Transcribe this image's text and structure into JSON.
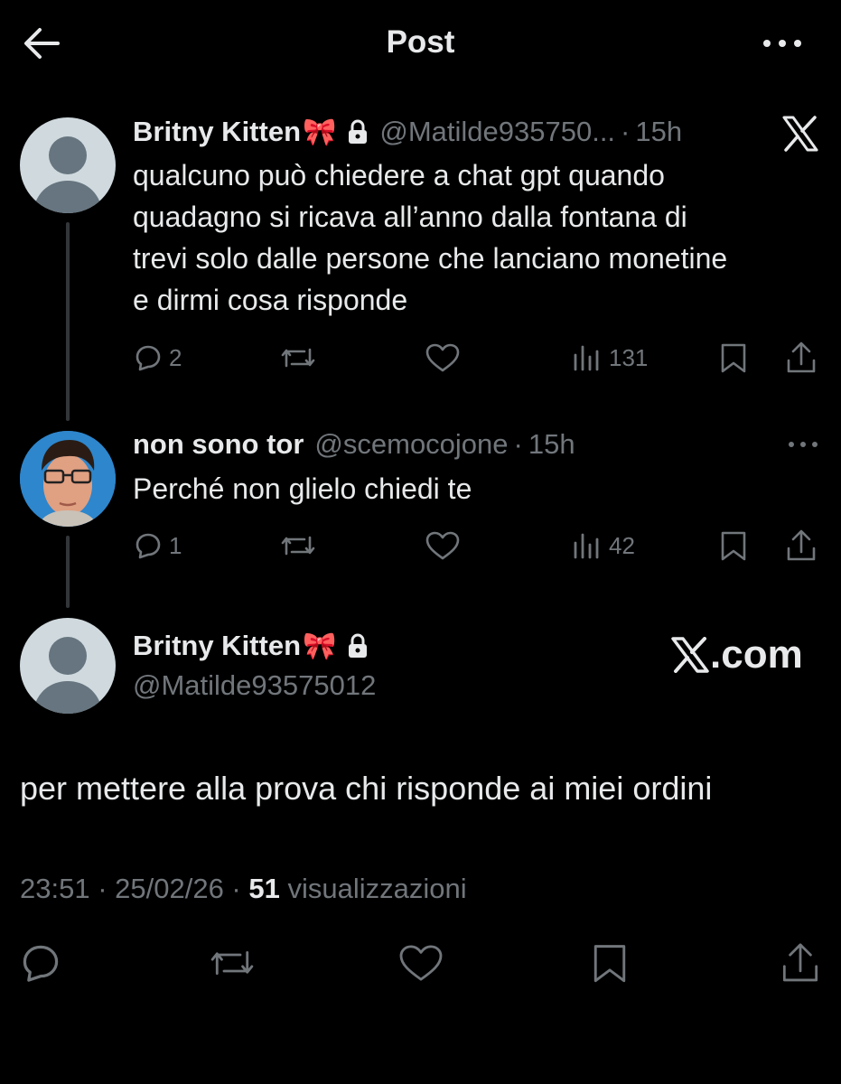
{
  "header": {
    "title": "Post",
    "back_icon": "arrow-left-icon",
    "more_icon": "more-horizontal-icon"
  },
  "thread": [
    {
      "author_name": "Britny Kitten",
      "emoji": "🎀",
      "protected": true,
      "handle": "@Matilde935750...",
      "time": "15h",
      "text_lines": [
        "qualcuno può chiedere a chat gpt quando",
        "quadagno si ricava all’anno dalla fontana di",
        "trevi solo dalle persone che lanciano monetine",
        "e dirmi cosa risponde"
      ],
      "replies": "2",
      "views": "131"
    },
    {
      "author_name": "non sono tor",
      "handle": "@scemocojone",
      "time": "15h",
      "text": "Perché non glielo chiedi te",
      "replies": "1",
      "views": "42"
    }
  ],
  "main_post": {
    "author_name": "Britny Kitten",
    "emoji": "🎀",
    "protected": true,
    "handle": "@Matilde93575012",
    "text": "per mettere alla prova chi risponde ai miei ordini",
    "time": "23:51",
    "date": "25/02/26",
    "views_count": "51",
    "views_label": "visualizzazioni"
  },
  "watermark": {
    "text": ".com"
  },
  "colors": {
    "background": "#000000",
    "text": "#e7e9ea",
    "muted": "#71767b",
    "line": "#333639",
    "avatar_default": "#cfd9de"
  }
}
